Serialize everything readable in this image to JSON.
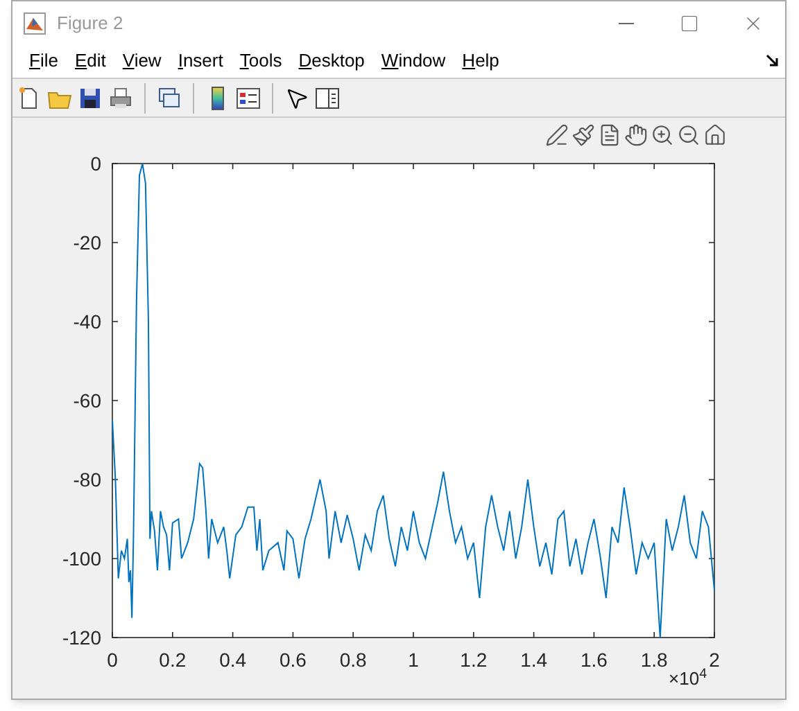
{
  "window": {
    "title": "Figure 2"
  },
  "menu": [
    {
      "label": "File"
    },
    {
      "label": "Edit"
    },
    {
      "label": "View"
    },
    {
      "label": "Insert"
    },
    {
      "label": "Tools"
    },
    {
      "label": "Desktop"
    },
    {
      "label": "Window"
    },
    {
      "label": "Help"
    }
  ],
  "toolbar": [
    {
      "kind": "new"
    },
    {
      "kind": "open"
    },
    {
      "kind": "save"
    },
    {
      "kind": "print"
    },
    {
      "kind": "sep"
    },
    {
      "kind": "link"
    },
    {
      "kind": "sep"
    },
    {
      "kind": "colorbar"
    },
    {
      "kind": "legend"
    },
    {
      "kind": "sep"
    },
    {
      "kind": "pointer"
    },
    {
      "kind": "inspector"
    }
  ],
  "axes_toolbar": [
    {
      "kind": "edit"
    },
    {
      "kind": "brush"
    },
    {
      "kind": "datatip"
    },
    {
      "kind": "pan"
    },
    {
      "kind": "zoomin"
    },
    {
      "kind": "zoomout"
    },
    {
      "kind": "home"
    }
  ],
  "plot": {
    "exponent": "×10$^{4}$",
    "chart_data": {
      "type": "line",
      "xlim": [
        0,
        2
      ],
      "ylim": [
        -120,
        0
      ],
      "xticks": [
        {
          "value": 0,
          "label": "0"
        },
        {
          "value": 0.2,
          "label": "0.2"
        },
        {
          "value": 0.4,
          "label": "0.4"
        },
        {
          "value": 0.6,
          "label": "0.6"
        },
        {
          "value": 0.8,
          "label": "0.8"
        },
        {
          "value": 1,
          "label": "1"
        },
        {
          "value": 1.2,
          "label": "1.2"
        },
        {
          "value": 1.4,
          "label": "1.4"
        },
        {
          "value": 1.6,
          "label": "1.6"
        },
        {
          "value": 1.8,
          "label": "1.8"
        },
        {
          "value": 2,
          "label": "2"
        }
      ],
      "yticks": [
        {
          "value": 0,
          "label": "0"
        },
        {
          "value": -20,
          "label": "-20"
        },
        {
          "value": -40,
          "label": "-40"
        },
        {
          "value": -60,
          "label": "-60"
        },
        {
          "value": -80,
          "label": "-80"
        },
        {
          "value": -100,
          "label": "-100"
        },
        {
          "value": -120,
          "label": "-120"
        }
      ],
      "x": [
        0,
        0.01,
        0.02,
        0.03,
        0.04,
        0.05,
        0.055,
        0.06,
        0.065,
        0.07,
        0.08,
        0.09,
        0.1,
        0.11,
        0.12,
        0.125,
        0.13,
        0.14,
        0.15,
        0.16,
        0.17,
        0.18,
        0.19,
        0.2,
        0.22,
        0.23,
        0.25,
        0.27,
        0.29,
        0.3,
        0.31,
        0.32,
        0.33,
        0.35,
        0.37,
        0.38,
        0.39,
        0.41,
        0.43,
        0.45,
        0.47,
        0.48,
        0.49,
        0.5,
        0.52,
        0.55,
        0.57,
        0.58,
        0.6,
        0.62,
        0.64,
        0.66,
        0.69,
        0.71,
        0.72,
        0.74,
        0.76,
        0.78,
        0.8,
        0.82,
        0.84,
        0.86,
        0.88,
        0.9,
        0.92,
        0.94,
        0.96,
        0.98,
        1,
        1.02,
        1.04,
        1.06,
        1.08,
        1.1,
        1.12,
        1.14,
        1.16,
        1.18,
        1.2,
        1.22,
        1.24,
        1.26,
        1.28,
        1.3,
        1.32,
        1.34,
        1.36,
        1.38,
        1.4,
        1.42,
        1.44,
        1.46,
        1.48,
        1.5,
        1.52,
        1.54,
        1.56,
        1.58,
        1.6,
        1.62,
        1.64,
        1.66,
        1.68,
        1.7,
        1.72,
        1.74,
        1.76,
        1.78,
        1.8,
        1.82,
        1.84,
        1.86,
        1.88,
        1.9,
        1.92,
        1.94,
        1.96,
        1.98,
        2
      ],
      "series": [
        {
          "color": "#0072bd",
          "values": [
            -65,
            -80,
            -105,
            -98,
            -100,
            -95,
            -106,
            -103,
            -115,
            -95,
            -35,
            -3,
            0,
            -5,
            -40,
            -95,
            -88,
            -93,
            -103,
            -88,
            -92,
            -94,
            -103,
            -91,
            -90,
            -100,
            -96,
            -90,
            -76,
            -77,
            -87,
            -100,
            -90,
            -96,
            -92,
            -98,
            -105,
            -94,
            -92,
            -87,
            -87,
            -98,
            -90,
            -103,
            -98,
            -96,
            -103,
            -93,
            -95,
            -105,
            -95,
            -90,
            -80,
            -88,
            -100,
            -88,
            -96,
            -89,
            -95,
            -103,
            -94,
            -98,
            -88,
            -84,
            -95,
            -102,
            -92,
            -98,
            -88,
            -96,
            -100,
            -93,
            -86,
            -78,
            -88,
            -96,
            -92,
            -100,
            -96,
            -110,
            -92,
            -84,
            -92,
            -98,
            -88,
            -100,
            -92,
            -80,
            -92,
            -102,
            -96,
            -104,
            -90,
            -88,
            -102,
            -95,
            -104,
            -96,
            -90,
            -99,
            -110,
            -92,
            -96,
            -82,
            -92,
            -104,
            -96,
            -100,
            -96,
            -120,
            -90,
            -98,
            -92,
            -84,
            -96,
            -100,
            -88,
            -92,
            -108
          ]
        }
      ]
    }
  }
}
